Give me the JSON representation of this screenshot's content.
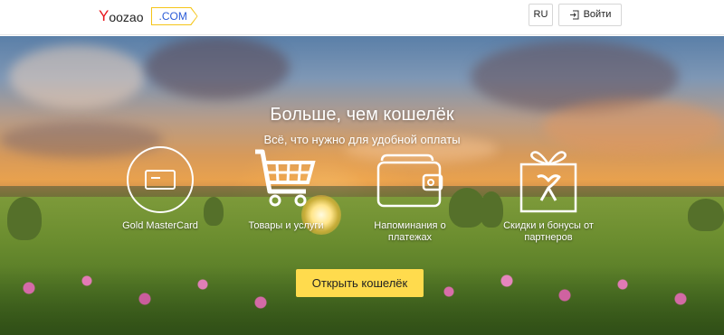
{
  "header": {
    "logo": {
      "first_letter": "Y",
      "rest": "oozao",
      "tld": ".COM"
    },
    "lang_label": "RU",
    "login_label": "Войти",
    "login_icon": "login-arrow-icon"
  },
  "hero": {
    "title": "Больше, чем кошелёк",
    "subtitle": "Всё, что нужно для удобной оплаты",
    "features": [
      {
        "icon": "card-icon",
        "label": "Gold MasterCard"
      },
      {
        "icon": "shopping-cart-icon",
        "label": "Товары и услуги"
      },
      {
        "icon": "wallet-icon",
        "label": "Напоминания о платежах"
      },
      {
        "icon": "gift-icon",
        "label": "Скидки и бонусы от партнеров"
      }
    ],
    "cta_label": "Открыть кошелёк"
  },
  "colors": {
    "cta_bg": "#ffdb4d",
    "logo_red": "#e8161c",
    "logo_blue": "#2a5bd7",
    "logo_border": "#f5c518"
  }
}
